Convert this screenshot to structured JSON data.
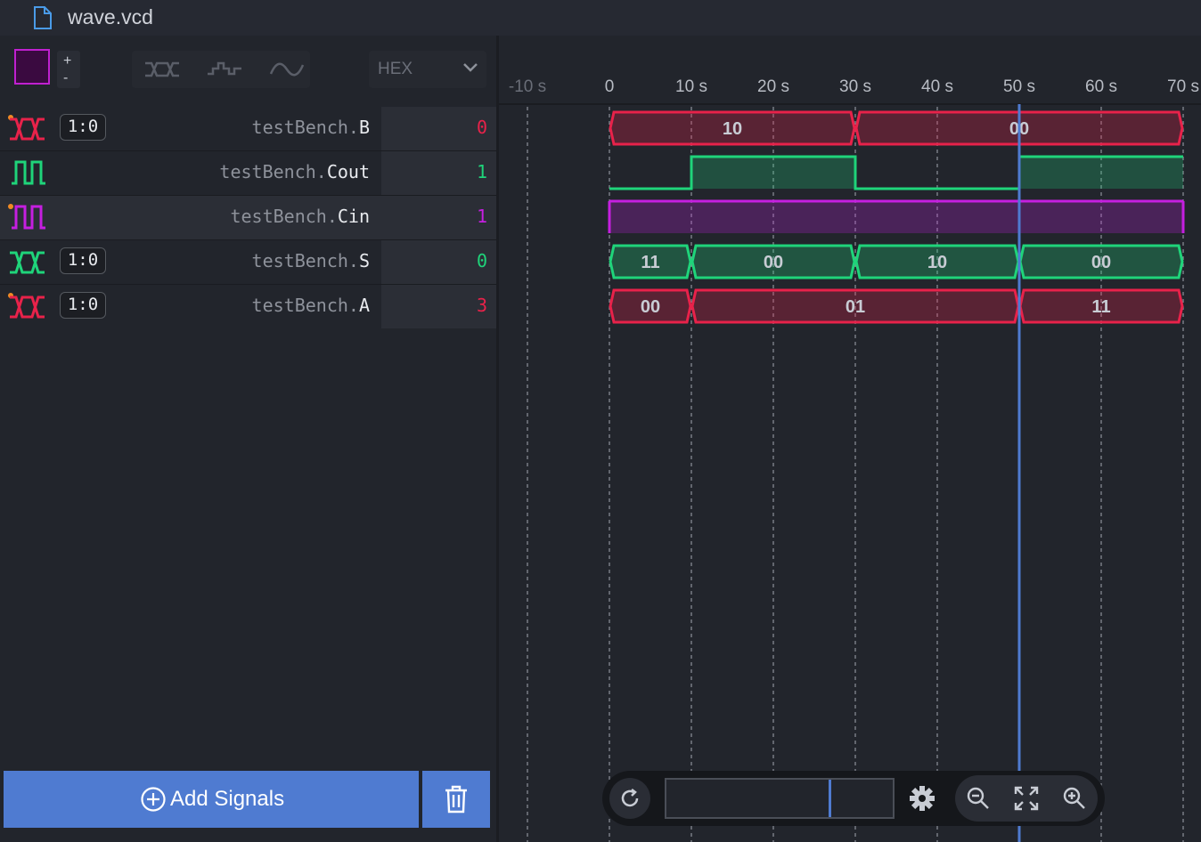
{
  "tab": {
    "title": "wave.vcd",
    "icon": "file-icon"
  },
  "toolbar": {
    "color_swatch": "#3a0a40",
    "plus_label": "+",
    "minus_label": "-",
    "render_modes": [
      "bus-render-icon",
      "step-render-icon",
      "analog-render-icon"
    ],
    "radix_value": "HEX"
  },
  "signals": [
    {
      "name_prefix": "testBench.",
      "name": "B",
      "width": "1:0",
      "value": "0",
      "color": "#e8224a",
      "type": "bus"
    },
    {
      "name_prefix": "testBench.",
      "name": "Cout",
      "width": "",
      "value": "1",
      "color": "#1fd47a",
      "type": "bit"
    },
    {
      "name_prefix": "testBench.",
      "name": "Cin",
      "width": "",
      "value": "1",
      "color": "#c51fe0",
      "type": "bit"
    },
    {
      "name_prefix": "testBench.",
      "name": "S",
      "width": "1:0",
      "value": "0",
      "color": "#1fd47a",
      "type": "bus"
    },
    {
      "name_prefix": "testBench.",
      "name": "A",
      "width": "1:0",
      "value": "3",
      "color": "#e8224a",
      "type": "bus"
    }
  ],
  "buttons": {
    "add_signals": "Add Signals"
  },
  "timeline": {
    "ticks": [
      "-10 s",
      "0",
      "10 s",
      "20 s",
      "30 s",
      "40 s",
      "50 s",
      "60 s",
      "70 s"
    ],
    "tick_times": [
      -10,
      0,
      10,
      20,
      30,
      40,
      50,
      60,
      70
    ],
    "cursor_time": 50,
    "cursor_color": "#4f7bd1"
  },
  "waveforms": [
    {
      "signal": "B",
      "type": "bus",
      "segments": [
        {
          "start": 0,
          "end": 30,
          "value": "10"
        },
        {
          "start": 30,
          "end": 70,
          "value": "00"
        }
      ]
    },
    {
      "signal": "Cout",
      "type": "bit",
      "segments": [
        {
          "start": 0,
          "end": 10,
          "value": 0
        },
        {
          "start": 10,
          "end": 30,
          "value": 1
        },
        {
          "start": 30,
          "end": 50,
          "value": 0
        },
        {
          "start": 50,
          "end": 70,
          "value": 1
        }
      ]
    },
    {
      "signal": "Cin",
      "type": "bit",
      "segments": [
        {
          "start": 0,
          "end": 70,
          "value": 1
        }
      ]
    },
    {
      "signal": "S",
      "type": "bus",
      "segments": [
        {
          "start": 0,
          "end": 10,
          "value": "11"
        },
        {
          "start": 10,
          "end": 30,
          "value": "00"
        },
        {
          "start": 30,
          "end": 50,
          "value": "10"
        },
        {
          "start": 50,
          "end": 70,
          "value": "00"
        }
      ]
    },
    {
      "signal": "A",
      "type": "bus",
      "segments": [
        {
          "start": 0,
          "end": 10,
          "value": "00"
        },
        {
          "start": 10,
          "end": 50,
          "value": "01"
        },
        {
          "start": 50,
          "end": 70,
          "value": "11"
        }
      ]
    }
  ],
  "controls": {
    "icons": [
      "refresh-icon",
      "gear-icon",
      "zoom-out-icon",
      "zoom-fit-icon",
      "zoom-in-icon"
    ]
  }
}
